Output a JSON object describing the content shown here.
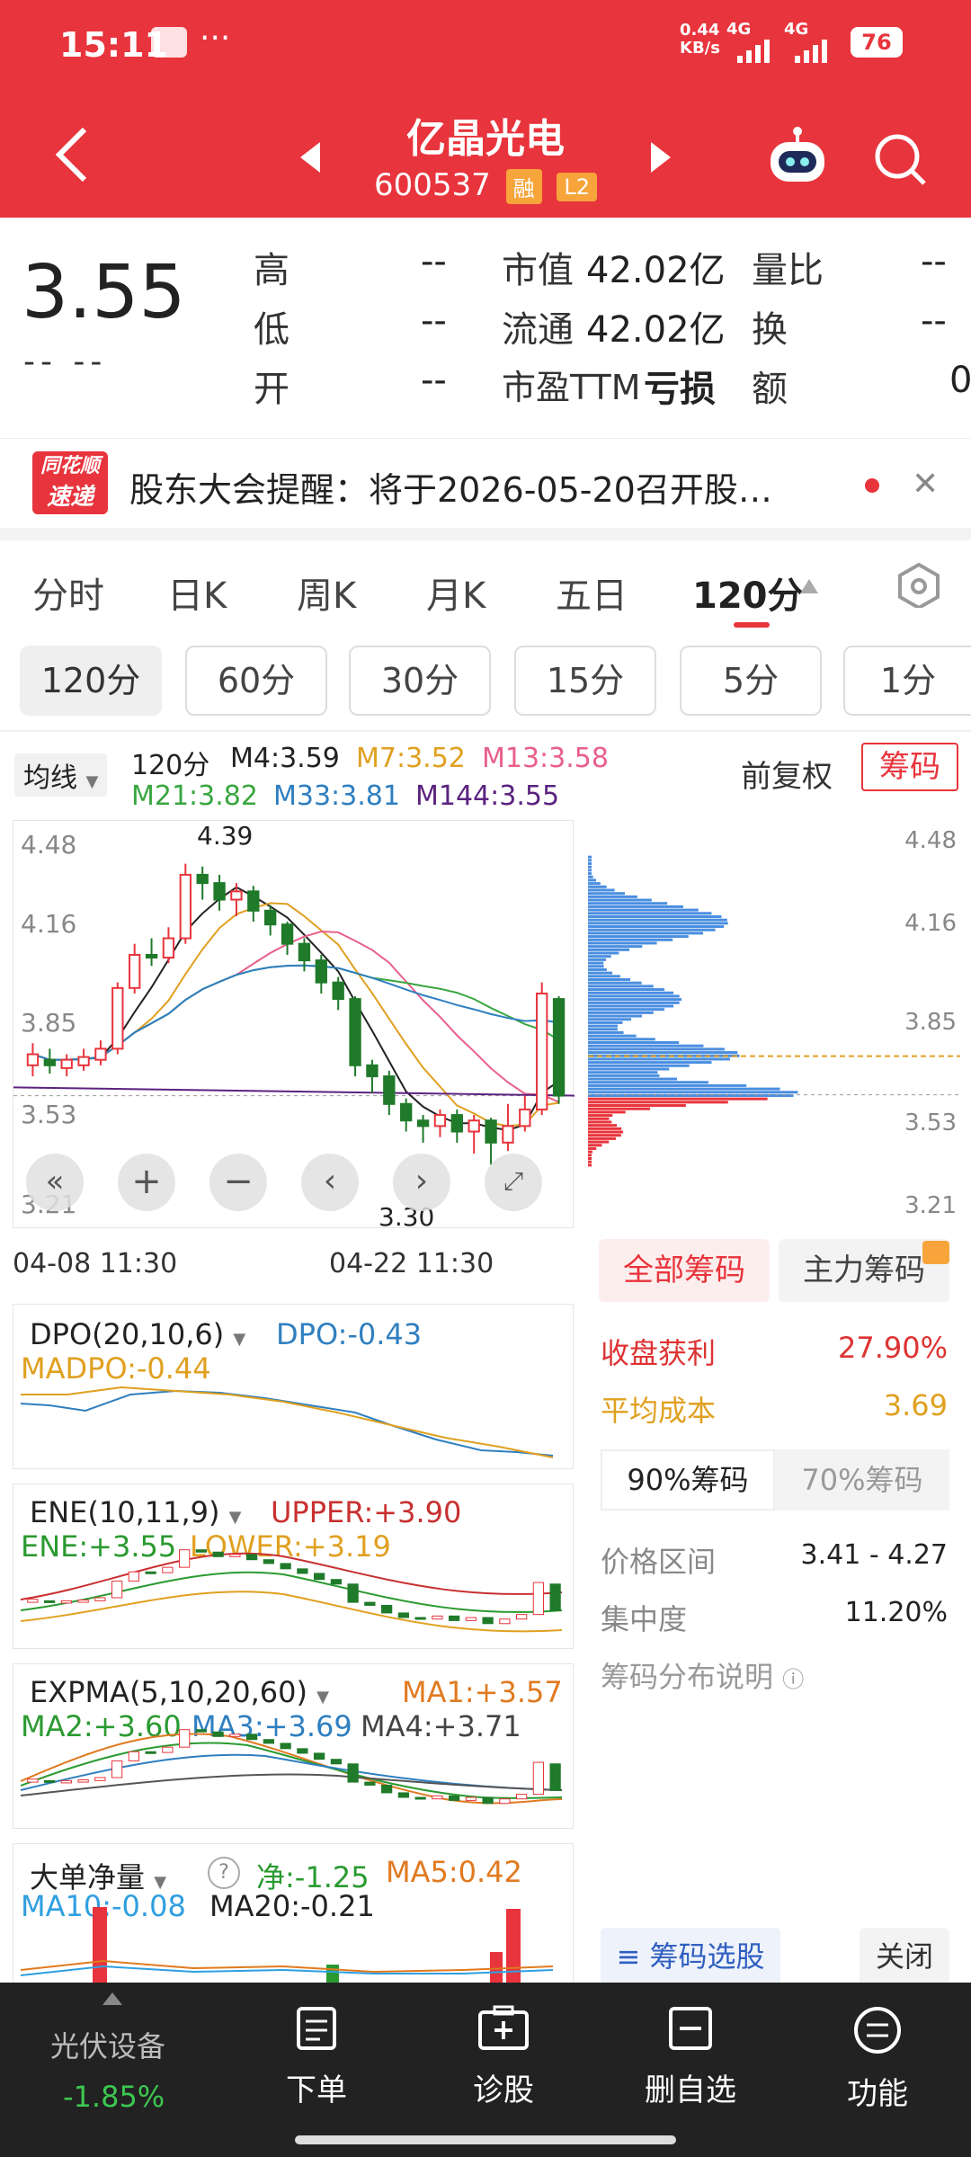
{
  "status_bar": {
    "time": "15:11",
    "dots": "···",
    "speed": "0.44\nKB/s",
    "net1": "4G",
    "net2": "4G",
    "battery": "76"
  },
  "header": {
    "title": "亿晶光电",
    "code": "600537",
    "tag1": "融",
    "tag2": "L2",
    "back_icon": "back-arrow-icon",
    "search_icon": "search-icon"
  },
  "quote": {
    "price": "3.55",
    "change": "-- --",
    "high_label": "高",
    "high_val": "--",
    "low_label": "低",
    "low_val": "--",
    "open_label": "开",
    "open_val": "--",
    "mcap_label": "市值",
    "mcap_val": "42.02亿",
    "float_label": "流通",
    "float_val": "42.02亿",
    "pe_label": "市盈TTM",
    "pe_val": "亏损",
    "vr_label": "量比",
    "vr_val": "--",
    "turn_label": "换",
    "turn_val": "--",
    "amt_label": "额",
    "amt_val": "0"
  },
  "news": {
    "logo_top": "同花顺",
    "logo_bottom": "速递",
    "text": "股东大会提醒：将于2026-05-20召开股…"
  },
  "period_tabs": [
    "分时",
    "日K",
    "周K",
    "月K",
    "五日",
    "120分"
  ],
  "minute_tabs": [
    "120分",
    "60分",
    "30分",
    "15分",
    "5分",
    "1分"
  ],
  "ma_legend": {
    "selector": "均线",
    "period": "120分",
    "m4": "M4:3.59",
    "m7": "M7:3.52",
    "m13": "M13:3.58",
    "m21": "M21:3.82",
    "m33": "M33:3.81",
    "m144": "M144:3.55",
    "restore": "前复权",
    "chips_btn": "筹码"
  },
  "main_chart": {
    "y_ticks": [
      "4.48",
      "4.16",
      "3.85",
      "3.53",
      "3.21"
    ],
    "right_ticks": [
      "4.48",
      "4.16",
      "3.85",
      "3.53",
      "3.21"
    ],
    "high_label": "4.39",
    "low_label": "3.30",
    "dates": [
      "04-08 11:30",
      "04-22 11:30"
    ]
  },
  "chart_data": {
    "type": "candlestick",
    "candles": [
      {
        "o": 3.66,
        "c": 3.7,
        "h": 3.74,
        "l": 3.62
      },
      {
        "o": 3.68,
        "c": 3.66,
        "h": 3.72,
        "l": 3.63
      },
      {
        "o": 3.65,
        "c": 3.68,
        "h": 3.7,
        "l": 3.62
      },
      {
        "o": 3.66,
        "c": 3.69,
        "h": 3.72,
        "l": 3.64
      },
      {
        "o": 3.68,
        "c": 3.72,
        "h": 3.75,
        "l": 3.66
      },
      {
        "o": 3.72,
        "c": 3.94,
        "h": 3.96,
        "l": 3.7
      },
      {
        "o": 3.94,
        "c": 4.06,
        "h": 4.1,
        "l": 3.92
      },
      {
        "o": 4.06,
        "c": 4.05,
        "h": 4.12,
        "l": 4.02
      },
      {
        "o": 4.05,
        "c": 4.12,
        "h": 4.16,
        "l": 4.03
      },
      {
        "o": 4.12,
        "c": 4.35,
        "h": 4.39,
        "l": 4.1
      },
      {
        "o": 4.35,
        "c": 4.32,
        "h": 4.38,
        "l": 4.26
      },
      {
        "o": 4.32,
        "c": 4.26,
        "h": 4.35,
        "l": 4.22
      },
      {
        "o": 4.26,
        "c": 4.29,
        "h": 4.32,
        "l": 4.2
      },
      {
        "o": 4.29,
        "c": 4.22,
        "h": 4.31,
        "l": 4.18
      },
      {
        "o": 4.22,
        "c": 4.17,
        "h": 4.24,
        "l": 4.13
      },
      {
        "o": 4.17,
        "c": 4.1,
        "h": 4.18,
        "l": 4.06
      },
      {
        "o": 4.1,
        "c": 4.04,
        "h": 4.12,
        "l": 4.0
      },
      {
        "o": 4.04,
        "c": 3.96,
        "h": 4.06,
        "l": 3.92
      },
      {
        "o": 3.96,
        "c": 3.9,
        "h": 3.98,
        "l": 3.86
      },
      {
        "o": 3.9,
        "c": 3.66,
        "h": 3.91,
        "l": 3.62
      },
      {
        "o": 3.66,
        "c": 3.62,
        "h": 3.68,
        "l": 3.56
      },
      {
        "o": 3.62,
        "c": 3.52,
        "h": 3.64,
        "l": 3.48
      },
      {
        "o": 3.52,
        "c": 3.46,
        "h": 3.54,
        "l": 3.42
      },
      {
        "o": 3.46,
        "c": 3.44,
        "h": 3.48,
        "l": 3.38
      },
      {
        "o": 3.44,
        "c": 3.48,
        "h": 3.5,
        "l": 3.4
      },
      {
        "o": 3.48,
        "c": 3.42,
        "h": 3.5,
        "l": 3.38
      },
      {
        "o": 3.42,
        "c": 3.46,
        "h": 3.48,
        "l": 3.34
      },
      {
        "o": 3.46,
        "c": 3.38,
        "h": 3.47,
        "l": 3.3
      },
      {
        "o": 3.38,
        "c": 3.44,
        "h": 3.52,
        "l": 3.35
      },
      {
        "o": 3.44,
        "c": 3.5,
        "h": 3.55,
        "l": 3.42
      },
      {
        "o": 3.5,
        "c": 3.92,
        "h": 3.96,
        "l": 3.48
      },
      {
        "o": 3.9,
        "c": 3.55,
        "h": 3.91,
        "l": 3.52
      }
    ],
    "ylim": [
      3.21,
      4.48
    ],
    "chip_high": 4.27,
    "chip_low": 3.41
  },
  "chips": {
    "tab_all": "全部筹码",
    "tab_main": "主力筹码",
    "profit_label": "收盘获利",
    "profit_val": "27.90%",
    "cost_label": "平均成本",
    "cost_val": "3.69",
    "sub_tab_90": "90%筹码",
    "sub_tab_70": "70%筹码",
    "range_label": "价格区间",
    "range_val": "3.41 - 4.27",
    "conc_label": "集中度",
    "conc_val": "11.20%",
    "desc": "筹码分布说明",
    "select_btn": "筹码选股",
    "close_btn": "关闭"
  },
  "indicators": {
    "dpo": {
      "name": "DPO(20,10,6)",
      "v1": "DPO:-0.43",
      "v2": "MADPO:-0.44"
    },
    "ene": {
      "name": "ENE(10,11,9)",
      "v1": "UPPER:+3.90",
      "v2": "ENE:+3.55",
      "v3": "LOWER:+3.19"
    },
    "expma": {
      "name": "EXPMA(5,10,20,60)",
      "v1": "MA1:+3.57",
      "v2": "MA2:+3.60",
      "v3": "MA3:+3.69",
      "v4": "MA4:+3.71"
    },
    "big": {
      "name": "大单净量",
      "v1": "净:-1.25",
      "v2": "MA5:0.42",
      "v3": "MA10:-0.08",
      "v4": "MA20:-0.21"
    }
  },
  "bottom_nav": {
    "sector": "光伏设备",
    "sector_change": "-1.85%",
    "items": [
      "下单",
      "诊股",
      "删自选",
      "功能"
    ]
  }
}
